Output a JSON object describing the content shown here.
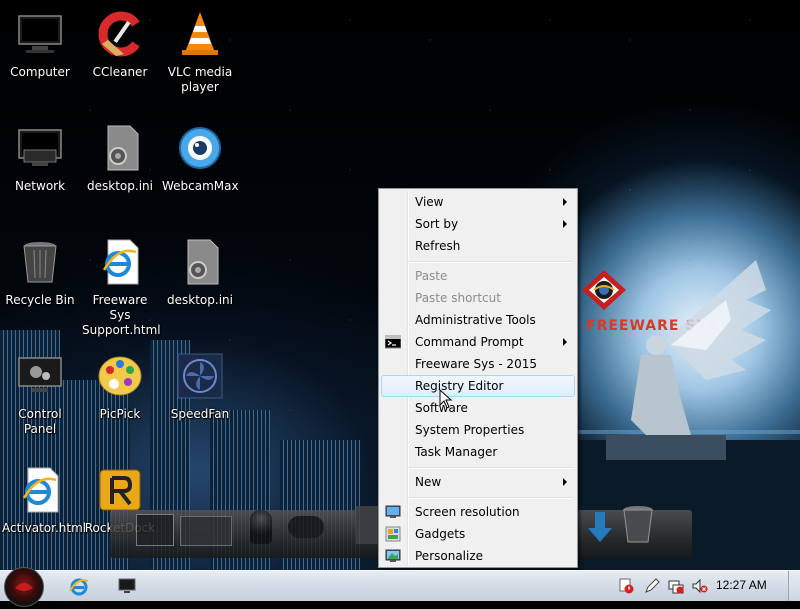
{
  "desktop": {
    "icons": [
      {
        "label": "Computer",
        "icon": "monitor-icon"
      },
      {
        "label": "CCleaner",
        "icon": "ccleaner-icon"
      },
      {
        "label": "VLC media player",
        "icon": "vlc-cone-icon"
      },
      {
        "label": "Network",
        "icon": "network-monitor-icon"
      },
      {
        "label": "desktop.ini",
        "icon": "settings-file-icon"
      },
      {
        "label": "WebcamMax",
        "icon": "webcam-icon"
      },
      {
        "label": "Recycle Bin",
        "icon": "recycle-bin-icon"
      },
      {
        "label": "Freeware Sys Support.html",
        "icon": "ie-document-icon"
      },
      {
        "label": "desktop.ini",
        "icon": "settings-file-icon"
      },
      {
        "label": "Control Panel",
        "icon": "control-panel-icon"
      },
      {
        "label": "PicPick",
        "icon": "palette-icon"
      },
      {
        "label": "SpeedFan",
        "icon": "fan-icon"
      },
      {
        "label": "Activator.html",
        "icon": "ie-document-icon"
      },
      {
        "label": "RocketDock",
        "icon": "rocketdock-icon"
      }
    ],
    "wallpaper_logo": "FREEWARE SYS"
  },
  "context_menu": {
    "items": [
      {
        "label": "View",
        "submenu": true
      },
      {
        "label": "Sort by",
        "submenu": true
      },
      {
        "label": "Refresh"
      },
      {
        "label": "Paste",
        "disabled": true
      },
      {
        "label": "Paste shortcut",
        "disabled": true
      },
      {
        "label": "Administrative Tools"
      },
      {
        "label": "Command Prompt",
        "submenu": true,
        "icon": "cmd-icon"
      },
      {
        "label": "Freeware Sys - 2015"
      },
      {
        "label": "Registry Editor",
        "hovered": true
      },
      {
        "label": "Software"
      },
      {
        "label": "System Properties"
      },
      {
        "label": "Task Manager"
      },
      {
        "label": "New",
        "submenu": true
      },
      {
        "label": "Screen resolution",
        "icon": "display-icon"
      },
      {
        "label": "Gadgets",
        "icon": "gadgets-icon"
      },
      {
        "label": "Personalize",
        "icon": "personalize-icon"
      }
    ]
  },
  "taskbar": {
    "pinned": [
      "ie-icon",
      "monitor-icon"
    ],
    "tray_icons": [
      "shield-alert-icon",
      "pen-icon",
      "network-icon",
      "volume-muted-icon"
    ],
    "clock": "12:27 AM"
  },
  "colors": {
    "menu_bg": "#f0f0f0",
    "hover_border": "#a8d8f5",
    "disabled_text": "#8d8d8d",
    "logo_red": "#d83a2a"
  }
}
